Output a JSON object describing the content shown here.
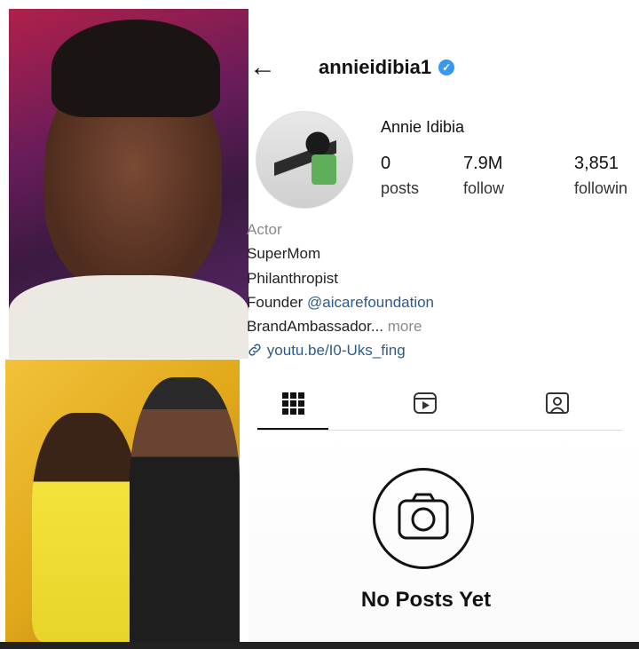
{
  "profile": {
    "username": "annieidibia1",
    "display_name": "Annie Idibia",
    "verified_color": "#3897f0",
    "stats": [
      {
        "value": "0",
        "label": "posts"
      },
      {
        "value": "7.9M",
        "label": "follow"
      },
      {
        "value": "3,851",
        "label": "followin"
      }
    ],
    "bio": {
      "category": "Actor",
      "line1": "SuperMom",
      "line2": "Philanthropist",
      "founder_prefix": "Founder ",
      "founder_handle": "@aicarefoundation",
      "line4": "BrandAmbassador...",
      "more": "more",
      "link": "youtu.be/I0-Uks_fing"
    }
  },
  "tabs": [
    {
      "icon": "grid-icon",
      "active": true
    },
    {
      "icon": "reels-icon",
      "active": false
    },
    {
      "icon": "tagged-icon",
      "active": false
    }
  ],
  "empty_state": {
    "icon": "camera-icon",
    "text": "No Posts Yet"
  },
  "icons": {
    "back": "←",
    "verified": "✓",
    "link": "🔗"
  },
  "colors": {
    "link": "#2c5a8a",
    "muted": "#8a8a8a",
    "text": "#111111"
  }
}
